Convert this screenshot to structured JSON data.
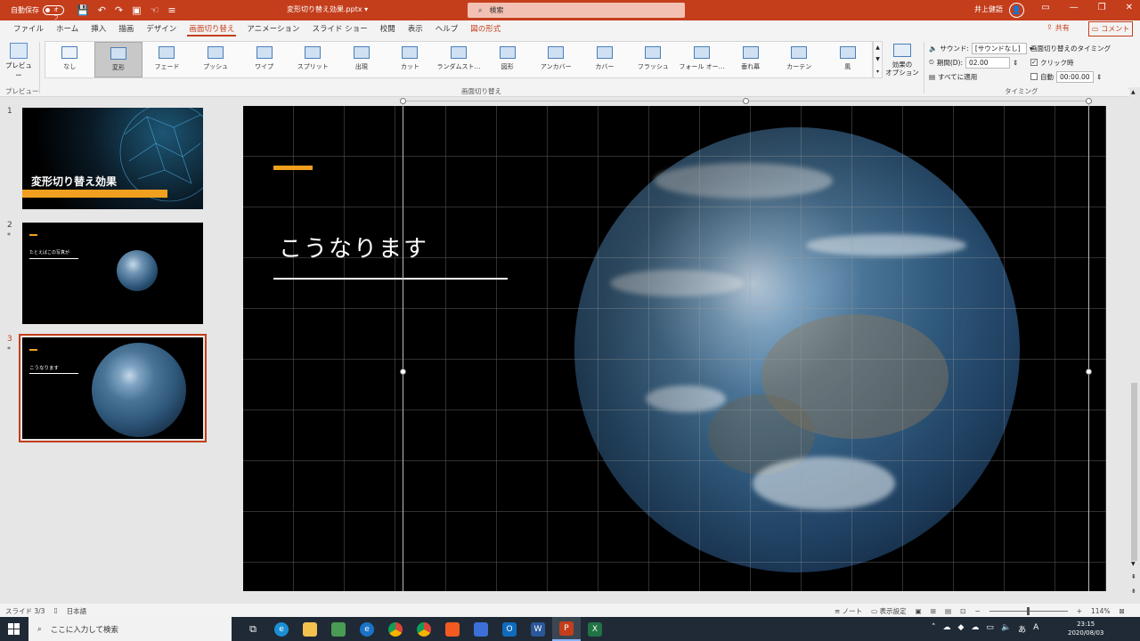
{
  "titlebar": {
    "autosave_label": "自動保存",
    "autosave_state": "オフ",
    "doc_title": "変形切り替え効果.pptx",
    "doc_title_arrow": "▾",
    "search_placeholder": "検索",
    "user_name": "井上健語",
    "window_buttons": [
      "▭",
      "—",
      "❐",
      "✕"
    ]
  },
  "tabs": [
    "ファイル",
    "ホーム",
    "挿入",
    "描画",
    "デザイン",
    "画面切り替え",
    "アニメーション",
    "スライド ショー",
    "校閲",
    "表示",
    "ヘルプ",
    "図の形式"
  ],
  "active_tab": "画面切り替え",
  "share_label": "共有",
  "comment_label": "コメント",
  "ribbon": {
    "preview_label": "プレビュー",
    "preview_group": "プレビュー",
    "transitions_group": "画面切り替え",
    "timing_group": "タイミング",
    "effects": [
      "なし",
      "変形",
      "フェード",
      "プッシュ",
      "ワイプ",
      "スプリット",
      "出現",
      "カット",
      "ランダムスト…",
      "図形",
      "アンカバー",
      "カバー",
      "フラッシュ",
      "フォール オー…",
      "垂れ幕",
      "カーテン",
      "風"
    ],
    "selected_effect": "変形",
    "options_label_1": "効果の",
    "options_label_2": "オプション",
    "sound_label": "サウンド:",
    "sound_value": "[サウンドなし]",
    "duration_label": "期間(D):",
    "duration_value": "02.00",
    "apply_all_label": "すべてに適用",
    "timing_title": "画面切り替えのタイミング",
    "on_click_label": "クリック時",
    "auto_label": "自動",
    "auto_value": "00:00.00"
  },
  "slides": [
    {
      "number": "1",
      "title": "変形切り替え効果",
      "star": ""
    },
    {
      "number": "2",
      "title": "たとえばこの写真が",
      "star": "*"
    },
    {
      "number": "3",
      "title": "こうなります",
      "star": "*"
    }
  ],
  "current_slide": {
    "title": "こうなります"
  },
  "status": {
    "slide_info": "スライド 3/3",
    "language": "日本語",
    "notes_label": "ノート",
    "display_settings_label": "表示設定",
    "zoom": "114%"
  },
  "taskbar": {
    "search_placeholder": "ここに入力して検索",
    "ime": "あ",
    "time": "23:15",
    "date": "2020/08/03"
  },
  "colors": {
    "accent": "#c43e1c",
    "slide_accent": "#f0a01e"
  }
}
